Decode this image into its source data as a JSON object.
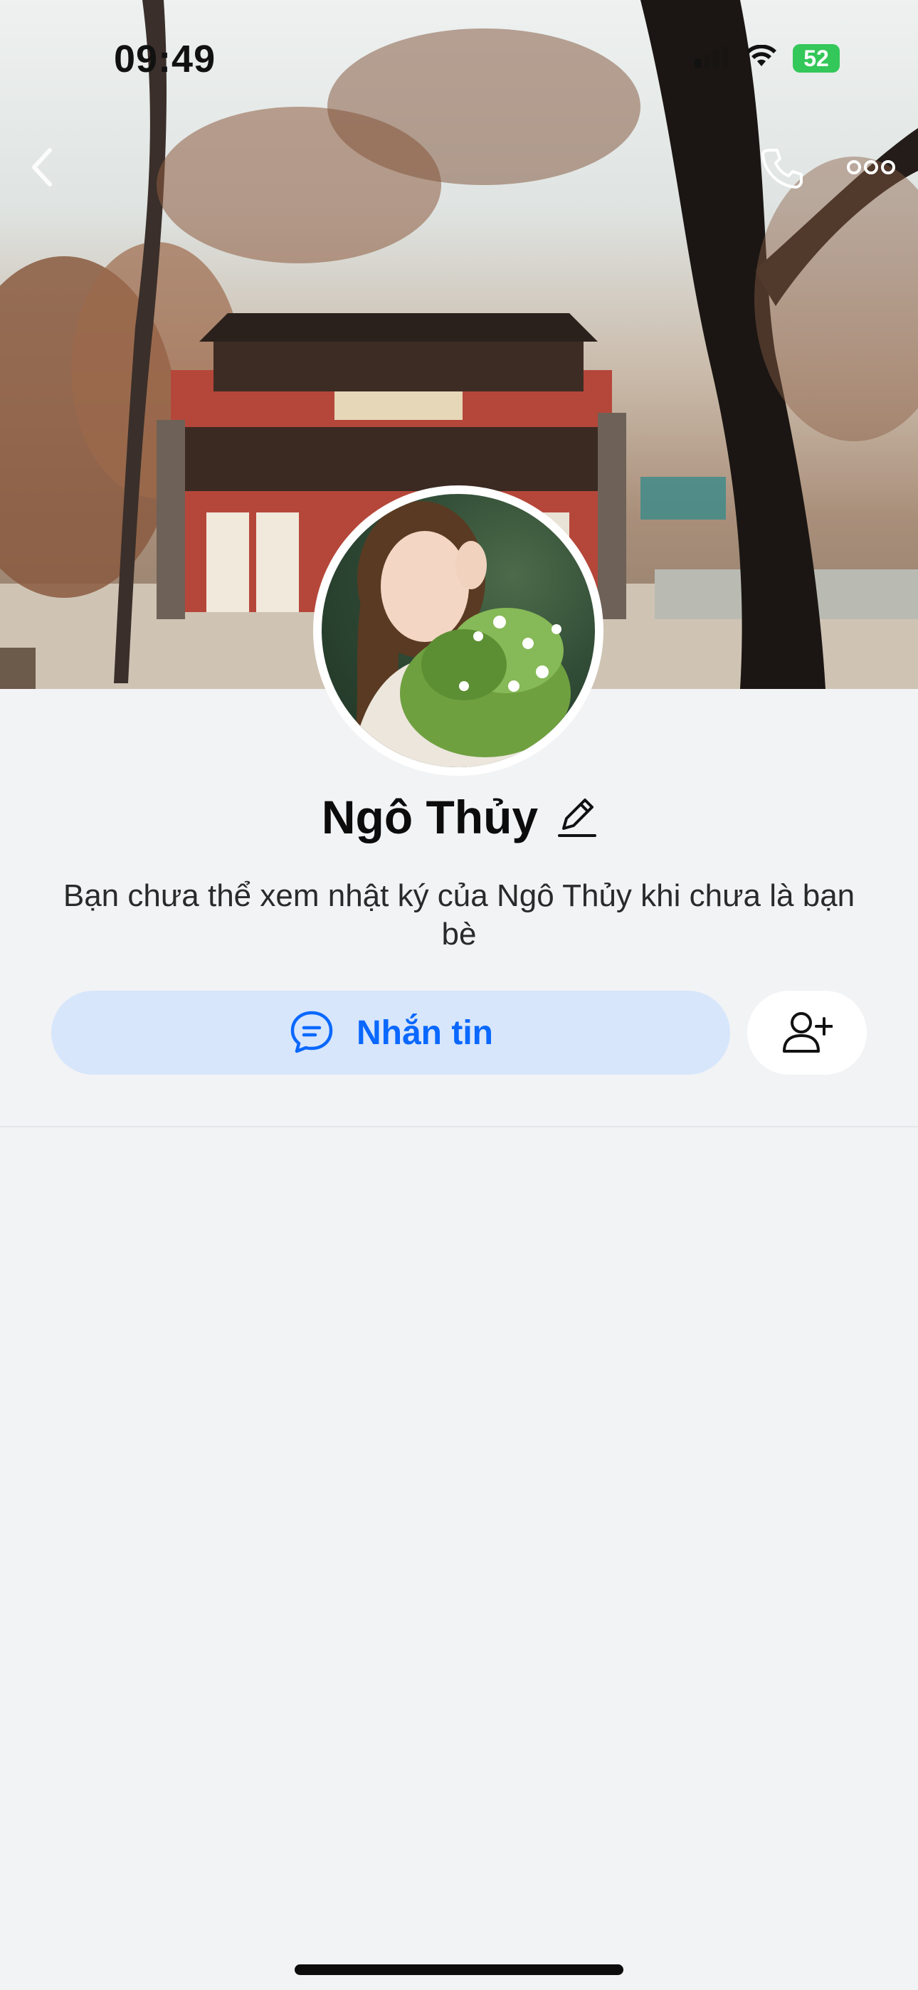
{
  "status_bar": {
    "time": "09:49",
    "battery": "52"
  },
  "profile": {
    "name": "Ngô Thủy",
    "info": "Bạn chưa thể xem nhật ký của Ngô Thủy khi chưa là bạn bè"
  },
  "actions": {
    "message_label": "Nhắn tin"
  },
  "icons": {
    "back": "chevron-left-icon",
    "call": "phone-icon",
    "more": "more-horizontal-icon",
    "edit": "pencil-icon",
    "message": "chat-bubble-icon",
    "add_friend": "user-plus-icon"
  },
  "colors": {
    "accent": "#0a68ff",
    "accent_bg": "#d7e6fb",
    "battery": "#34c759",
    "page_bg": "#f2f3f5"
  }
}
